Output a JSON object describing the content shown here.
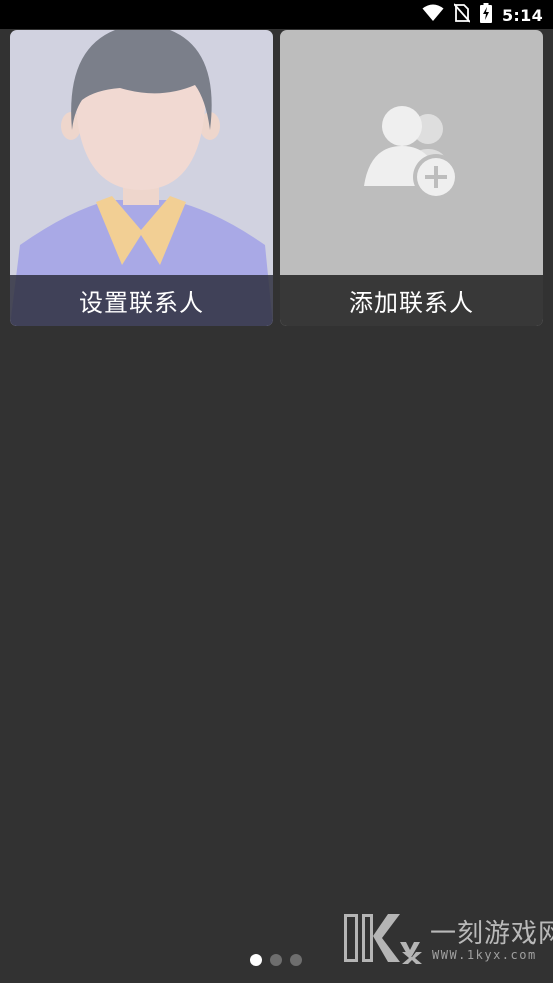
{
  "status_bar": {
    "time": "5:14",
    "icons": [
      "wifi-icon",
      "no-sim-icon",
      "battery-charging-icon"
    ]
  },
  "contacts": [
    {
      "label": "设置联系人",
      "icon": "default-avatar-icon",
      "background": "#d1d2e0"
    },
    {
      "label": "添加联系人",
      "icon": "add-contact-icon",
      "background": "#bdbdbd"
    }
  ],
  "pager": {
    "total_pages": 3,
    "active_page": 1
  },
  "watermark": {
    "logo_text": "1Kyx",
    "name": "一刻游戏网",
    "url": "WWW.1kyx.com"
  },
  "colors": {
    "background": "#323232",
    "status_bar": "#000000",
    "label_bar": "#383838",
    "dot_active": "#ffffff",
    "dot_inactive": "#6e6e6e"
  }
}
